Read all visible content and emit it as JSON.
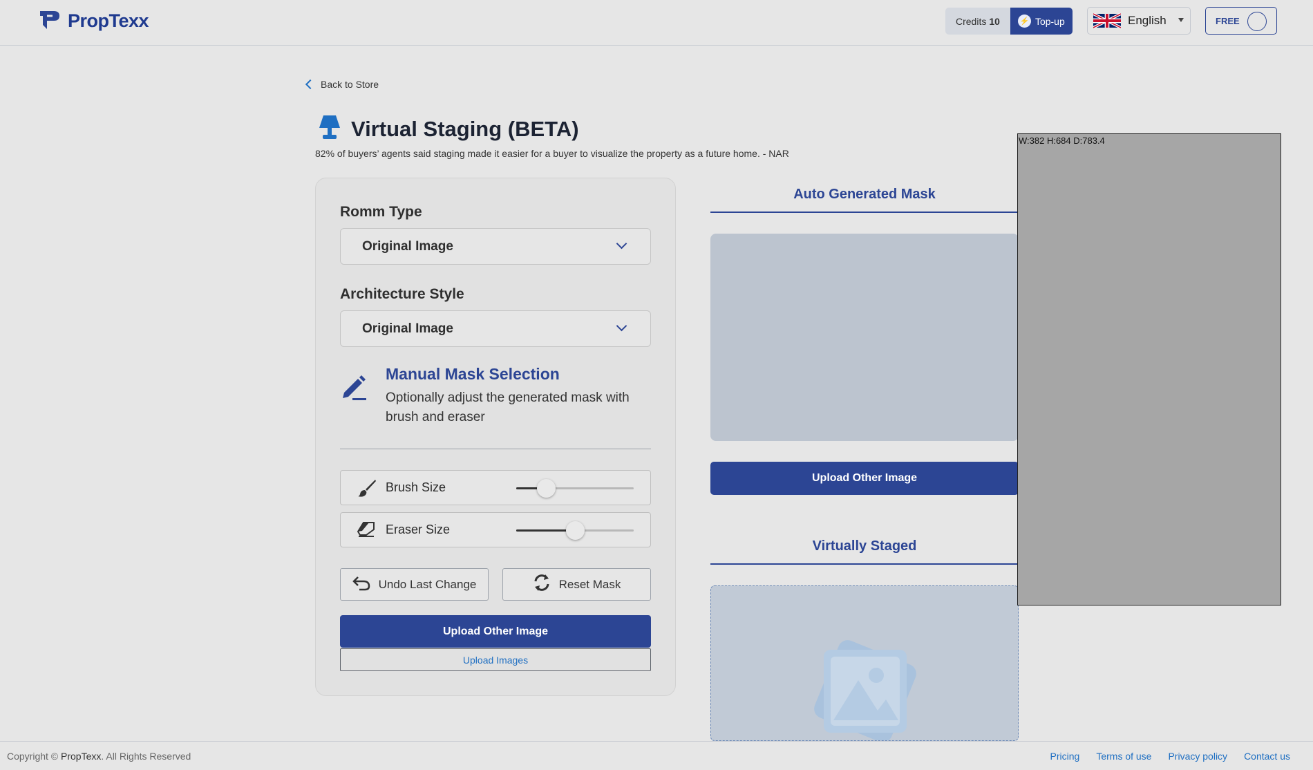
{
  "header": {
    "logo_text": "PropTexx",
    "credits_label": "Credits",
    "credits_value": "10",
    "topup_label": "Top-up",
    "language": "English",
    "plan": "FREE"
  },
  "nav": {
    "back_label": "Back to Store"
  },
  "page": {
    "title": "Virtual Staging (BETA)",
    "subtitle": "82% of buyers’ agents said staging made it easier for a buyer to visualize the property as a future home. - NAR"
  },
  "form": {
    "room_type_label": "Romm Type",
    "room_type_value": "Original Image",
    "arch_style_label": "Architecture Style",
    "arch_style_value": "Original Image",
    "mask_title": "Manual Mask Selection",
    "mask_desc": "Optionally adjust the generated mask with brush and eraser",
    "brush_label": "Brush Size",
    "brush_value": 0.25,
    "eraser_label": "Eraser Size",
    "eraser_value": 0.5,
    "undo_label": "Undo Last Change",
    "reset_label": "Reset Mask",
    "upload_other_label": "Upload Other Image",
    "upload_images_label": "Upload Images"
  },
  "right": {
    "auto_mask_title": "Auto Generated Mask",
    "upload_other_label": "Upload Other Image",
    "staged_title": "Virtually Staged"
  },
  "debug": {
    "label": "W:382 H:684 D:783.4"
  },
  "footer": {
    "copyright_prefix": "Copyright © ",
    "copyright_brand": "PropTexx",
    "copyright_suffix": ". All Rights Reserved",
    "links": [
      "Pricing",
      "Terms of use",
      "Privacy policy",
      "Contact us"
    ]
  },
  "colors": {
    "primary": "#2c4594",
    "link": "#1f6fc2",
    "background": "#e6e6e6"
  },
  "icons": [
    "proptexx-logo-icon",
    "bolt-icon",
    "uk-flag-icon",
    "chevron-left-icon",
    "lamp-icon",
    "chevron-down-icon",
    "pen-icon",
    "brush-icon",
    "eraser-icon",
    "undo-icon",
    "refresh-icon",
    "image-placeholder-icon"
  ]
}
